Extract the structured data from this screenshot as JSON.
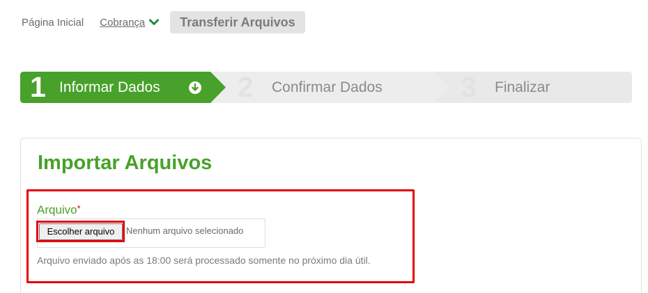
{
  "breadcrumb": {
    "home": "Página Inicial",
    "billing": "Cobrança",
    "current": "Transferir Arquivos"
  },
  "steps": [
    {
      "number": "1",
      "label": "Informar Dados",
      "state": "active"
    },
    {
      "number": "2",
      "label": "Confirmar Dados",
      "state": "inactive"
    },
    {
      "number": "3",
      "label": "Finalizar",
      "state": "inactive"
    }
  ],
  "panel": {
    "title": "Importar Arquivos",
    "field_label": "Arquivo",
    "required_mark": "*",
    "choose_button": "Escolher arquivo",
    "file_status": "Nenhum arquivo selecionado",
    "help": "Arquivo enviado após as 18:00 será processado somente no próximo dia útil."
  },
  "colors": {
    "brand_green": "#47a12a",
    "step_active": "#47a12a",
    "step_inactive": "#e9e9e9",
    "highlight_red": "#e5000b"
  },
  "icons": {
    "billing_dropdown": "chevron-down-icon",
    "step_active": "arrow-down-circle-icon"
  }
}
